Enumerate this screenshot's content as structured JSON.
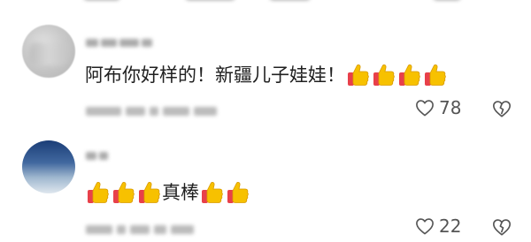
{
  "comments": [
    {
      "text": "阿布你好样的！新疆儿子娃娃！",
      "thumbs_before": 0,
      "thumbs_after": 4,
      "likes": "78"
    },
    {
      "text": "真棒",
      "thumbs_before": 3,
      "thumbs_after": 2,
      "likes": "22"
    }
  ],
  "icons": {
    "like": "heart-outline-icon",
    "dislike": "broken-heart-outline-icon",
    "emoji": "thumbs-up-emoji"
  },
  "colors": {
    "text": "#202020",
    "meta": "#555555",
    "thumb_yellow": "#f7c100",
    "thumb_cuff": "#e8404a"
  }
}
